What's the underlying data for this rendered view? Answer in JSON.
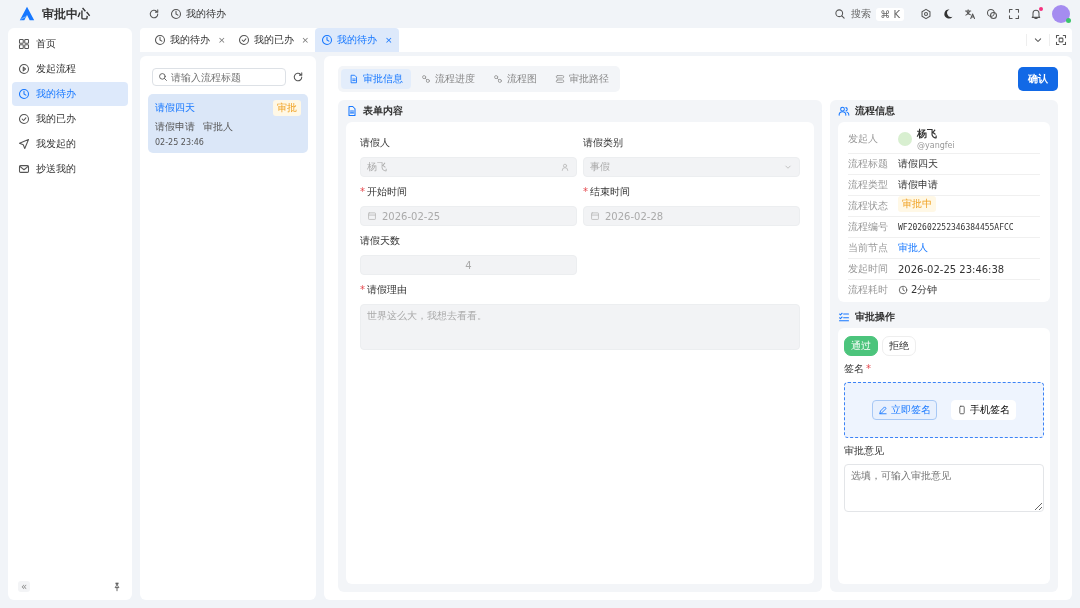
{
  "header": {
    "logo_text": "审批中心",
    "breadcrumb": "我的待办",
    "search_label": "搜索",
    "shortcut": "⌘ K",
    "notification": true,
    "avatar_online": true
  },
  "sidebar": {
    "items": [
      {
        "label": "首页",
        "kind": "grid",
        "selected": false
      },
      {
        "label": "发起流程",
        "kind": "play",
        "selected": false
      },
      {
        "label": "我的待办",
        "kind": "clock",
        "selected": true
      },
      {
        "label": "我的已办",
        "kind": "check",
        "selected": false
      },
      {
        "label": "我发起的",
        "kind": "send",
        "selected": false
      },
      {
        "label": "抄送我的",
        "kind": "mail",
        "selected": false
      }
    ],
    "collapse_label": "«"
  },
  "tabs": [
    {
      "label": "我的待办",
      "kind": "clock",
      "close": "×",
      "selected": false
    },
    {
      "label": "我的已办",
      "kind": "check",
      "close": "×",
      "selected": false
    },
    {
      "label": "我的待办",
      "kind": "clock",
      "close": "×",
      "selected": true
    }
  ],
  "task_list": {
    "search_placeholder": "请输入流程标题",
    "items": [
      {
        "title": "请假四天",
        "tag": "审批",
        "type": "请假申请",
        "node": "审批人",
        "time": "02-25 23:46",
        "selected": true
      }
    ]
  },
  "detail_tabs": [
    {
      "label": "审批信息",
      "kind": "doc",
      "selected": true
    },
    {
      "label": "流程进度",
      "kind": "flow",
      "selected": false
    },
    {
      "label": "流程图",
      "kind": "flow",
      "selected": false
    },
    {
      "label": "审批路径",
      "kind": "path",
      "selected": false
    }
  ],
  "confirm_button": "确认",
  "required_mark": "*",
  "form": {
    "title": "表单内容",
    "fields": [
      {
        "label": "请假人",
        "required": false,
        "value": "杨飞",
        "kind": "user",
        "disabled": true
      },
      {
        "label": "请假类别",
        "required": false,
        "value": "事假",
        "kind": "select",
        "disabled": true
      },
      {
        "label": "开始时间",
        "required": true,
        "value": "2026-02-25",
        "kind": "date",
        "disabled": true
      },
      {
        "label": "结束时间",
        "required": true,
        "value": "2026-02-28",
        "kind": "date",
        "disabled": true
      },
      {
        "label": "请假天数",
        "required": false,
        "value": "4",
        "kind": "number",
        "disabled": true
      },
      {
        "label": "请假理由",
        "required": true,
        "value": "世界这么大，我想去看看。",
        "kind": "textarea",
        "disabled": true
      }
    ]
  },
  "process_info": {
    "title": "流程信息",
    "rows": [
      {
        "label": "发起人",
        "kind": "user",
        "value": "杨飞",
        "sub": "@yangfei"
      },
      {
        "label": "流程标题",
        "kind": "text",
        "value": "请假四天"
      },
      {
        "label": "流程类型",
        "kind": "text",
        "value": "请假申请"
      },
      {
        "label": "流程状态",
        "kind": "tag",
        "value": "审批中"
      },
      {
        "label": "流程编号",
        "kind": "code",
        "value": "WF202602252346384455AFCC"
      },
      {
        "label": "当前节点",
        "kind": "link",
        "value": "审批人"
      },
      {
        "label": "发起时间",
        "kind": "text",
        "value": "2026-02-25 23:46:38"
      },
      {
        "label": "流程耗时",
        "kind": "duration",
        "value": "2分钟"
      }
    ]
  },
  "approval": {
    "title": "审批操作",
    "choices": [
      {
        "label": "通过",
        "selected": true
      },
      {
        "label": "拒绝",
        "selected": false
      }
    ],
    "signature_label": "签名",
    "signature_required": true,
    "sign_buttons": [
      {
        "label": "立即签名",
        "kind": "pen"
      },
      {
        "label": "手机签名",
        "kind": "phone"
      }
    ],
    "opinion_label": "审批意见",
    "opinion_placeholder": "选填，可输入审批意见"
  }
}
